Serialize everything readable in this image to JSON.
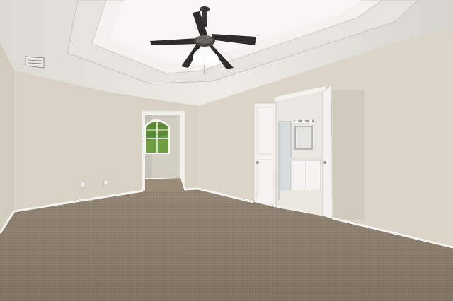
{
  "scene": {
    "kind": "empty-bedroom-photo",
    "objects": [
      "tray-ceiling",
      "ceiling-fan",
      "air-vent",
      "left-wall",
      "back-wall",
      "right-wall",
      "doorway-hallway",
      "arched-window",
      "double-doors",
      "bathroom-vanity",
      "mirror",
      "light-fixture",
      "carpet",
      "baseboards",
      "outlet"
    ],
    "colors": {
      "wall": "#d9d3c6",
      "wall_shadow": "#c9c3b5",
      "ceiling": "#eceae4",
      "carpet": "#9c8d7b",
      "trim": "#f4f3ef",
      "fan": "#2f2d2b",
      "window_green": "#5f8a3a"
    }
  }
}
